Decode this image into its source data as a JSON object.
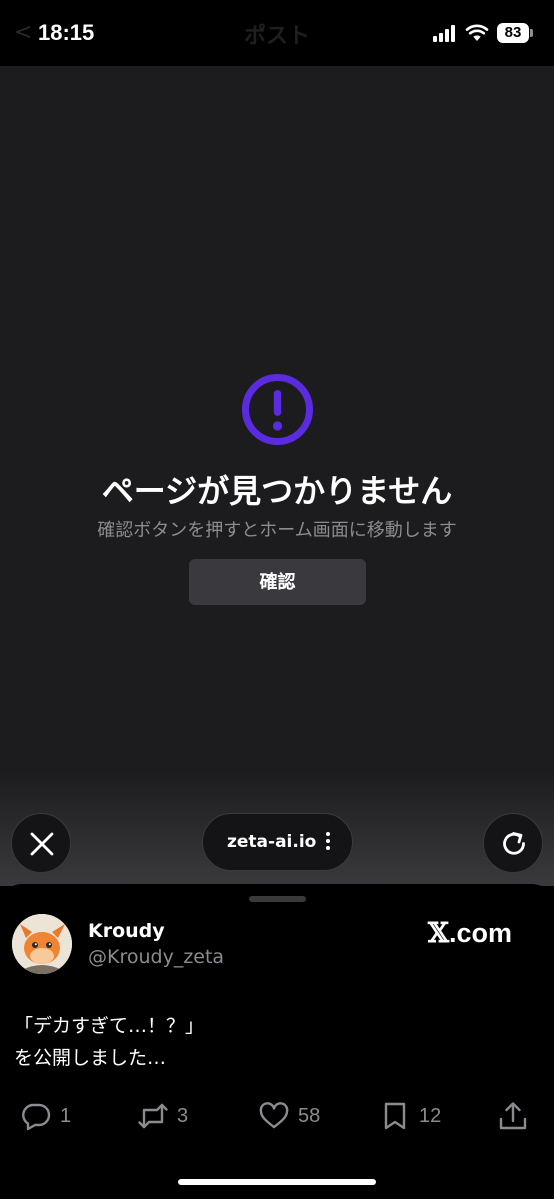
{
  "status_bar": {
    "time": "18:15",
    "battery": "83",
    "ghost_title": "ポスト",
    "ghost_back": "<"
  },
  "error": {
    "title": "ページが見つかりません",
    "description": "確認ボタンを押すとホーム画面に移動します",
    "confirm_label": "確認",
    "accent_color": "#5b2be0"
  },
  "browser": {
    "url": "zeta-ai.io"
  },
  "post": {
    "author_name": "Kroudy",
    "author_handle": "@Kroudy_zeta",
    "source_logo_x": "𝕏",
    "source_logo_rest": ".com",
    "text": "「デカすぎて…！？」\nを公開しました…",
    "replies": "1",
    "retweets": "3",
    "likes": "58",
    "bookmarks": "12"
  }
}
